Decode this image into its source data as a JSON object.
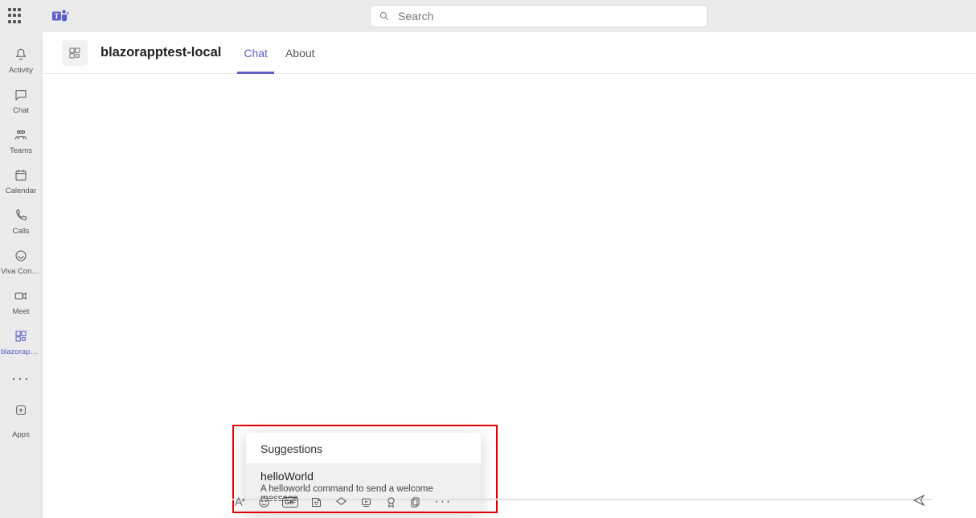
{
  "search": {
    "placeholder": "Search"
  },
  "rail": {
    "items": [
      {
        "label": "Activity"
      },
      {
        "label": "Chat"
      },
      {
        "label": "Teams"
      },
      {
        "label": "Calendar"
      },
      {
        "label": "Calls"
      },
      {
        "label": "Viva Connec..."
      },
      {
        "label": "Meet"
      },
      {
        "label": "blazorappt..."
      }
    ],
    "apps_label": "Apps"
  },
  "header": {
    "app_title": "blazorapptest-local",
    "tabs": [
      {
        "label": "Chat"
      },
      {
        "label": "About"
      }
    ]
  },
  "suggestions": {
    "header": "Suggestions",
    "items": [
      {
        "title": "helloWorld",
        "desc": "A helloworld command to send a welcome message"
      }
    ]
  },
  "toolbar": {
    "gif_label": "GIF"
  }
}
